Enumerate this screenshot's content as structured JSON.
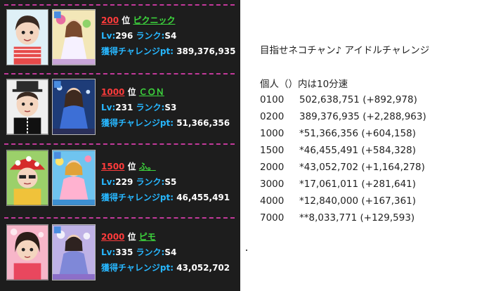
{
  "entries": [
    {
      "rank": "200",
      "rank_suffix": "位",
      "name": "ピクニック",
      "lv_label": "Lv:",
      "lv": "296",
      "rank_label": "ランク:",
      "rank_class": "S4",
      "pt_label": "獲得チャレンジpt:",
      "pt": "389,376,935"
    },
    {
      "rank": "1000",
      "rank_suffix": "位",
      "name": "ＣＯＮ",
      "lv_label": "Lv:",
      "lv": "231",
      "rank_label": "ランク:",
      "rank_class": "S3",
      "pt_label": "獲得チャレンジpt:",
      "pt": "51,366,356"
    },
    {
      "rank": "1500",
      "rank_suffix": "位",
      "name": "ふ。",
      "lv_label": "Lv:",
      "lv": "229",
      "rank_label": "ランク:",
      "rank_class": "S5",
      "pt_label": "獲得チャレンジpt:",
      "pt": "46,455,491"
    },
    {
      "rank": "2000",
      "rank_suffix": "位",
      "name": "ピモ",
      "lv_label": "Lv:",
      "lv": "335",
      "rank_label": "ランク:",
      "rank_class": "S4",
      "pt_label": "獲得チャレンジpt:",
      "pt": "43,052,702"
    }
  ],
  "event": {
    "title": "目指せネコチャン♪ アイドルチャレンジ",
    "header": "個人（）内は10分速"
  },
  "borders": [
    {
      "rank": "0100",
      "points": "502,638,751",
      "delta": "(+892,978)"
    },
    {
      "rank": "0200",
      "points": "389,376,935",
      "delta": "(+2,288,963)"
    },
    {
      "rank": "1000",
      "points": "*51,366,356",
      "delta": "(+604,158)"
    },
    {
      "rank": "1500",
      "points": "*46,455,491",
      "delta": "(+584,328)"
    },
    {
      "rank": "2000",
      "points": "*43,052,702",
      "delta": "(+1,164,278)"
    },
    {
      "rank": "3000",
      "points": "*17,061,011",
      "delta": "(+281,641)"
    },
    {
      "rank": "4000",
      "points": "*12,840,000",
      "delta": "(+167,361)"
    },
    {
      "rank": "7000",
      "points": "**8,033,771",
      "delta": "(+129,593)"
    }
  ],
  "colors": {
    "panel_bg": "#1d1d1d",
    "divider": "#c2399a",
    "rank_red": "#ff3b3b",
    "name_green": "#3dd63d",
    "label_blue": "#27b7ff"
  }
}
